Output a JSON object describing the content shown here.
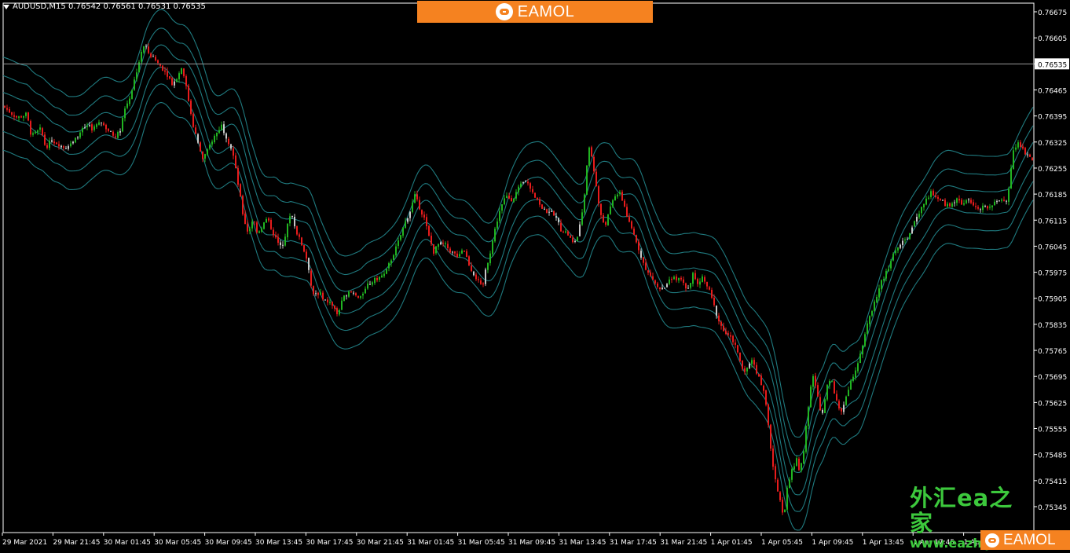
{
  "header": {
    "symbol_info": "AUDUSD,M15  0.76542 0.76561 0.76531 0.76535",
    "banner_text": "EAMOL",
    "banner_color": "#f58220"
  },
  "watermark": {
    "cn": "外汇ea之家",
    "url": "www.eazhijia.com"
  },
  "corner_logo": {
    "text": "EAMOL"
  },
  "colors": {
    "background": "#000000",
    "axis": "#ffffff",
    "band": "#1f7a7f",
    "bull": "#21b421",
    "bear": "#e81c1c",
    "neutral": "#c8c8c8"
  },
  "chart_data": {
    "type": "candlestick",
    "symbol": "AUDUSD",
    "timeframe": "M15",
    "current_price": "0.76535",
    "ylim": [
      0.7528,
      0.767
    ],
    "y_ticks": [
      "0.76675",
      "0.76605",
      "0.76535",
      "0.76465",
      "0.76395",
      "0.76325",
      "0.76255",
      "0.76185",
      "0.76115",
      "0.76045",
      "0.75975",
      "0.75905",
      "0.75835",
      "0.75765",
      "0.75695",
      "0.75625",
      "0.75555",
      "0.75485",
      "0.75415",
      "0.75345"
    ],
    "x_ticks": [
      "29 Mar 2021",
      "29 Mar 21:45",
      "30 Mar 01:45",
      "30 Mar 05:45",
      "30 Mar 09:45",
      "30 Mar 13:45",
      "30 Mar 17:45",
      "30 Mar 21:45",
      "31 Mar 01:45",
      "31 Mar 05:45",
      "31 Mar 09:45",
      "31 Mar 13:45",
      "31 Mar 17:45",
      "31 Mar 21:45",
      "1 Apr 01:45",
      "1 Apr 05:45",
      "1 Apr 09:45",
      "1 Apr 13:45",
      "1 Apr 17:45",
      "1 Apr 2"
    ],
    "close_path": [
      [
        0,
        0.7643
      ],
      [
        10,
        0.7641
      ],
      [
        22,
        0.7639
      ],
      [
        34,
        0.764
      ],
      [
        40,
        0.7634
      ],
      [
        52,
        0.7636
      ],
      [
        58,
        0.7631
      ],
      [
        66,
        0.7633
      ],
      [
        74,
        0.7632
      ],
      [
        82,
        0.7631
      ],
      [
        92,
        0.7632
      ],
      [
        102,
        0.7635
      ],
      [
        110,
        0.7637
      ],
      [
        118,
        0.7636
      ],
      [
        128,
        0.7638
      ],
      [
        136,
        0.7636
      ],
      [
        145,
        0.7634
      ],
      [
        152,
        0.7635
      ],
      [
        158,
        0.7641
      ],
      [
        166,
        0.7645
      ],
      [
        172,
        0.765
      ],
      [
        178,
        0.7655
      ],
      [
        184,
        0.7659
      ],
      [
        190,
        0.7656
      ],
      [
        196,
        0.7655
      ],
      [
        204,
        0.7653
      ],
      [
        212,
        0.7651
      ],
      [
        220,
        0.7648
      ],
      [
        226,
        0.765
      ],
      [
        232,
        0.7653
      ],
      [
        238,
        0.7646
      ],
      [
        246,
        0.7637
      ],
      [
        252,
        0.7632
      ],
      [
        258,
        0.7628
      ],
      [
        264,
        0.763
      ],
      [
        270,
        0.7633
      ],
      [
        276,
        0.7635
      ],
      [
        282,
        0.7637
      ],
      [
        288,
        0.7634
      ],
      [
        296,
        0.763
      ],
      [
        304,
        0.762
      ],
      [
        310,
        0.7612
      ],
      [
        316,
        0.7608
      ],
      [
        322,
        0.7612
      ],
      [
        328,
        0.7608
      ],
      [
        334,
        0.761
      ],
      [
        340,
        0.7612
      ],
      [
        346,
        0.7609
      ],
      [
        352,
        0.7606
      ],
      [
        358,
        0.7604
      ],
      [
        364,
        0.7608
      ],
      [
        370,
        0.7614
      ],
      [
        378,
        0.7608
      ],
      [
        386,
        0.7604
      ],
      [
        392,
        0.76
      ],
      [
        398,
        0.7591
      ],
      [
        406,
        0.7592
      ],
      [
        414,
        0.759
      ],
      [
        422,
        0.7589
      ],
      [
        430,
        0.7586
      ],
      [
        436,
        0.759
      ],
      [
        442,
        0.7592
      ],
      [
        450,
        0.7592
      ],
      [
        458,
        0.759
      ],
      [
        466,
        0.7594
      ],
      [
        474,
        0.7595
      ],
      [
        482,
        0.7596
      ],
      [
        490,
        0.7597
      ],
      [
        498,
        0.7601
      ],
      [
        506,
        0.7605
      ],
      [
        514,
        0.761
      ],
      [
        522,
        0.7614
      ],
      [
        528,
        0.7618
      ],
      [
        534,
        0.7615
      ],
      [
        540,
        0.7612
      ],
      [
        546,
        0.7607
      ],
      [
        552,
        0.7603
      ],
      [
        558,
        0.7605
      ],
      [
        566,
        0.7605
      ],
      [
        574,
        0.7603
      ],
      [
        582,
        0.7602
      ],
      [
        590,
        0.7604
      ],
      [
        598,
        0.7599
      ],
      [
        606,
        0.7596
      ],
      [
        614,
        0.7593
      ],
      [
        618,
        0.7598
      ],
      [
        624,
        0.7603
      ],
      [
        630,
        0.7609
      ],
      [
        636,
        0.7614
      ],
      [
        644,
        0.7618
      ],
      [
        652,
        0.7617
      ],
      [
        660,
        0.762
      ],
      [
        668,
        0.7622
      ],
      [
        676,
        0.762
      ],
      [
        684,
        0.7617
      ],
      [
        692,
        0.7614
      ],
      [
        700,
        0.7614
      ],
      [
        708,
        0.7612
      ],
      [
        714,
        0.7609
      ],
      [
        722,
        0.7608
      ],
      [
        730,
        0.7605
      ],
      [
        736,
        0.7608
      ],
      [
        742,
        0.7614
      ],
      [
        746,
        0.7624
      ],
      [
        750,
        0.7631
      ],
      [
        754,
        0.7628
      ],
      [
        758,
        0.7622
      ],
      [
        764,
        0.7613
      ],
      [
        770,
        0.761
      ],
      [
        776,
        0.7614
      ],
      [
        782,
        0.7618
      ],
      [
        788,
        0.7619
      ],
      [
        794,
        0.7616
      ],
      [
        800,
        0.7611
      ],
      [
        808,
        0.7607
      ],
      [
        816,
        0.7602
      ],
      [
        822,
        0.7598
      ],
      [
        830,
        0.7596
      ],
      [
        838,
        0.7593
      ],
      [
        846,
        0.7593
      ],
      [
        852,
        0.7595
      ],
      [
        860,
        0.7596
      ],
      [
        868,
        0.7595
      ],
      [
        876,
        0.7593
      ],
      [
        882,
        0.7597
      ],
      [
        888,
        0.7594
      ],
      [
        894,
        0.7596
      ],
      [
        902,
        0.7593
      ],
      [
        908,
        0.7589
      ],
      [
        914,
        0.7585
      ],
      [
        920,
        0.7582
      ],
      [
        928,
        0.758
      ],
      [
        934,
        0.7579
      ],
      [
        940,
        0.7575
      ],
      [
        946,
        0.7571
      ],
      [
        952,
        0.7572
      ],
      [
        958,
        0.7574
      ],
      [
        966,
        0.7569
      ],
      [
        972,
        0.7566
      ],
      [
        978,
        0.7557
      ],
      [
        982,
        0.7548
      ],
      [
        988,
        0.754
      ],
      [
        994,
        0.7535
      ],
      [
        998,
        0.7532
      ],
      [
        1002,
        0.754
      ],
      [
        1008,
        0.7544
      ],
      [
        1014,
        0.7547
      ],
      [
        1018,
        0.7544
      ],
      [
        1022,
        0.7548
      ],
      [
        1028,
        0.756
      ],
      [
        1034,
        0.757
      ],
      [
        1040,
        0.7565
      ],
      [
        1046,
        0.7558
      ],
      [
        1052,
        0.7566
      ],
      [
        1058,
        0.757
      ],
      [
        1064,
        0.7563
      ],
      [
        1070,
        0.756
      ],
      [
        1076,
        0.7563
      ],
      [
        1082,
        0.7568
      ],
      [
        1090,
        0.7572
      ],
      [
        1098,
        0.7578
      ],
      [
        1106,
        0.7585
      ],
      [
        1114,
        0.759
      ],
      [
        1122,
        0.7595
      ],
      [
        1130,
        0.7598
      ],
      [
        1138,
        0.7603
      ],
      [
        1146,
        0.7605
      ],
      [
        1154,
        0.7606
      ],
      [
        1162,
        0.761
      ],
      [
        1170,
        0.7613
      ],
      [
        1178,
        0.7617
      ],
      [
        1186,
        0.7619
      ],
      [
        1194,
        0.7617
      ],
      [
        1202,
        0.7616
      ],
      [
        1210,
        0.7615
      ],
      [
        1218,
        0.7617
      ],
      [
        1226,
        0.7616
      ],
      [
        1234,
        0.7617
      ],
      [
        1242,
        0.7615
      ],
      [
        1250,
        0.7615
      ],
      [
        1258,
        0.7615
      ],
      [
        1266,
        0.7616
      ],
      [
        1274,
        0.7617
      ],
      [
        1282,
        0.7617
      ],
      [
        1286,
        0.7624
      ],
      [
        1290,
        0.763
      ],
      [
        1296,
        0.7632
      ],
      [
        1304,
        0.763
      ],
      [
        1312,
        0.7628
      ],
      [
        1316,
        0.7627
      ]
    ],
    "bands": [
      {
        "name": "upper-3",
        "offset": 0.0013
      },
      {
        "name": "upper-2",
        "offset": 0.0008
      },
      {
        "name": "upper-1",
        "offset": 0.00035
      },
      {
        "name": "lower-1",
        "offset": -0.00025
      },
      {
        "name": "lower-2",
        "offset": -0.0007
      },
      {
        "name": "lower-3",
        "offset": -0.0012
      }
    ]
  }
}
